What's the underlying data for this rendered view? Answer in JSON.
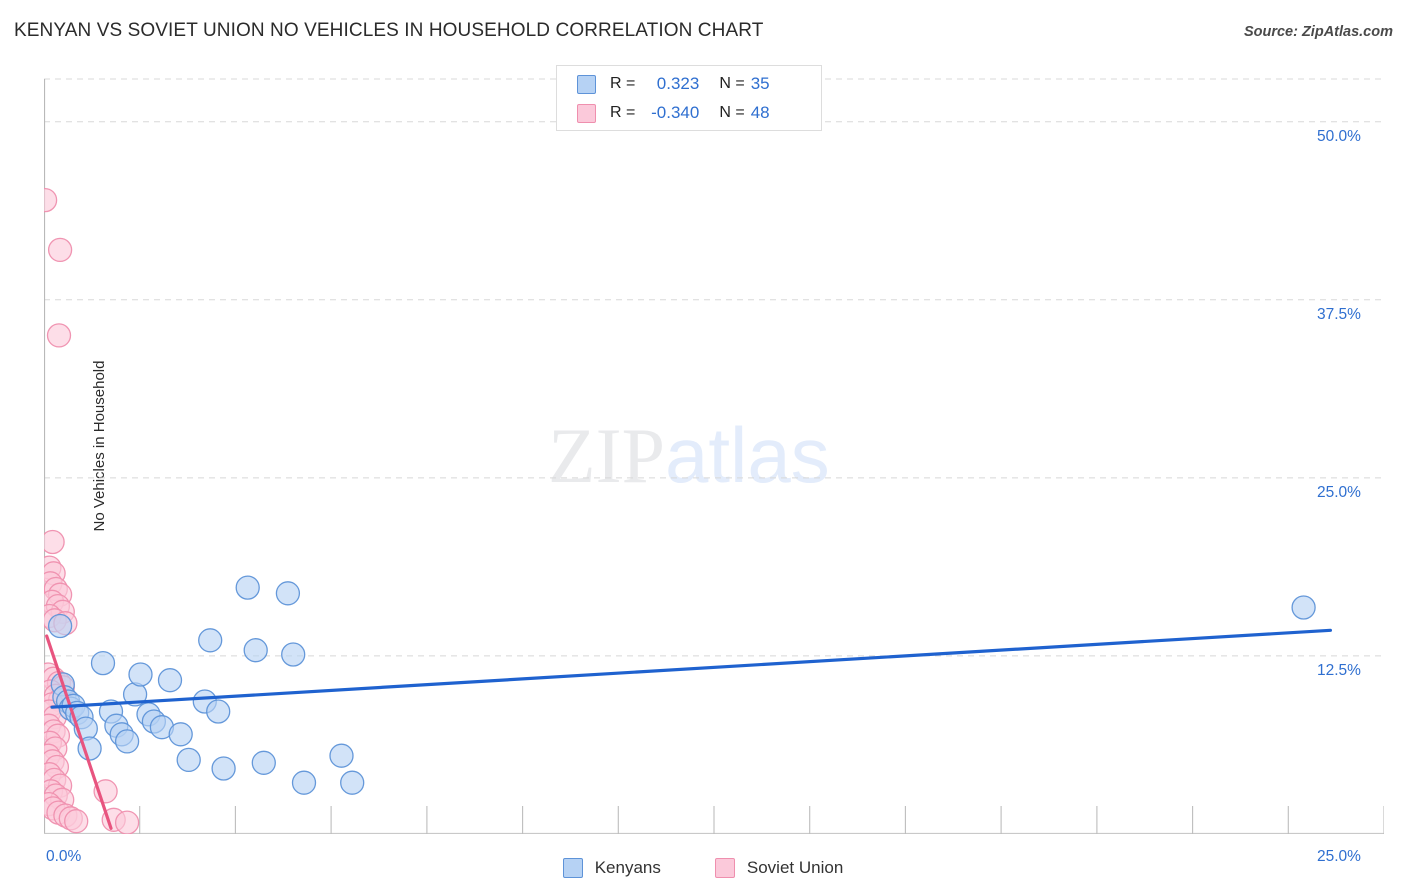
{
  "header": {
    "title": "KENYAN VS SOVIET UNION NO VEHICLES IN HOUSEHOLD CORRELATION CHART",
    "source": "Source: ZipAtlas.com"
  },
  "watermark": {
    "part1": "ZIP",
    "part2": "atlas"
  },
  "stats_legend": {
    "rows": [
      {
        "series": "Kenyans",
        "r_label": "R =",
        "r_value": "0.323",
        "n_label": "N =",
        "n_value": "35",
        "color": "#b6d2f4"
      },
      {
        "series": "Soviet Union",
        "r_label": "R =",
        "r_value": "-0.340",
        "n_label": "N =",
        "n_value": "48",
        "color": "#fbc9da"
      }
    ]
  },
  "bottom_legend": {
    "items": [
      {
        "label": "Kenyans",
        "color": "#b6d2f4",
        "border": "#5e93d8"
      },
      {
        "label": "Soviet Union",
        "color": "#fbc9da",
        "border": "#ef8fae"
      }
    ]
  },
  "chart_data": {
    "type": "scatter",
    "title": "KENYAN VS SOVIET UNION NO VEHICLES IN HOUSEHOLD CORRELATION CHART",
    "xlabel": "",
    "ylabel": "No Vehicles in Household",
    "xlim": [
      0.0,
      25.0
    ],
    "ylim": [
      0.0,
      53.0
    ],
    "x_unit": "%",
    "y_unit": "%",
    "grid": true,
    "legend_position": "bottom",
    "x_ticks": [
      {
        "value": 0.0,
        "label": "0.0%"
      },
      {
        "value": 25.0,
        "label": "25.0%"
      }
    ],
    "y_ticks": [
      {
        "value": 12.5,
        "label": "12.5%"
      },
      {
        "value": 25.0,
        "label": "25.0%"
      },
      {
        "value": 37.5,
        "label": "37.5%"
      },
      {
        "value": 50.0,
        "label": "50.0%"
      }
    ],
    "y_tick_side": "right",
    "series": [
      {
        "name": "Kenyans",
        "color": "#b6d2f4",
        "border": "#5e93d8",
        "r": 0.323,
        "n": 35,
        "trendline": {
          "x1": 0.15,
          "y1": 8.9,
          "x2": 24.0,
          "y2": 14.3,
          "color": "#1f62cf"
        },
        "points": [
          [
            0.3,
            14.6
          ],
          [
            0.35,
            10.5
          ],
          [
            0.38,
            9.6
          ],
          [
            0.45,
            9.3
          ],
          [
            0.5,
            8.8
          ],
          [
            0.55,
            9.0
          ],
          [
            0.62,
            8.5
          ],
          [
            0.7,
            8.2
          ],
          [
            0.78,
            7.4
          ],
          [
            0.85,
            6.0
          ],
          [
            1.1,
            12.0
          ],
          [
            1.25,
            8.6
          ],
          [
            1.35,
            7.6
          ],
          [
            1.45,
            7.0
          ],
          [
            1.55,
            6.5
          ],
          [
            1.7,
            9.8
          ],
          [
            1.8,
            11.2
          ],
          [
            1.95,
            8.4
          ],
          [
            2.05,
            7.9
          ],
          [
            2.2,
            7.5
          ],
          [
            2.35,
            10.8
          ],
          [
            2.55,
            7.0
          ],
          [
            2.7,
            5.2
          ],
          [
            3.0,
            9.3
          ],
          [
            3.1,
            13.6
          ],
          [
            3.25,
            8.6
          ],
          [
            3.35,
            4.6
          ],
          [
            3.8,
            17.3
          ],
          [
            3.95,
            12.9
          ],
          [
            4.1,
            5.0
          ],
          [
            4.55,
            16.9
          ],
          [
            4.65,
            12.6
          ],
          [
            4.85,
            3.6
          ],
          [
            5.55,
            5.5
          ],
          [
            5.75,
            3.6
          ],
          [
            23.5,
            15.9
          ]
        ]
      },
      {
        "name": "Soviet Union",
        "color": "#fbc9da",
        "border": "#ef8fae",
        "r": -0.34,
        "n": 48,
        "trendline": {
          "x1": 0.05,
          "y1": 13.9,
          "x2": 1.25,
          "y2": 0.4,
          "color": "#e8547f"
        },
        "points": [
          [
            0.02,
            44.5
          ],
          [
            0.3,
            41.0
          ],
          [
            0.28,
            35.0
          ],
          [
            0.16,
            20.5
          ],
          [
            0.1,
            18.7
          ],
          [
            0.18,
            18.3
          ],
          [
            0.12,
            17.6
          ],
          [
            0.22,
            17.2
          ],
          [
            0.3,
            16.8
          ],
          [
            0.15,
            16.3
          ],
          [
            0.26,
            16.0
          ],
          [
            0.35,
            15.6
          ],
          [
            0.1,
            15.3
          ],
          [
            0.2,
            15.0
          ],
          [
            0.4,
            14.8
          ],
          [
            0.08,
            11.2
          ],
          [
            0.18,
            10.9
          ],
          [
            0.28,
            10.6
          ],
          [
            0.35,
            10.3
          ],
          [
            0.12,
            10.0
          ],
          [
            0.22,
            9.7
          ],
          [
            0.3,
            9.4
          ],
          [
            0.15,
            9.1
          ],
          [
            0.1,
            8.6
          ],
          [
            0.2,
            8.2
          ],
          [
            0.09,
            7.6
          ],
          [
            0.18,
            7.2
          ],
          [
            0.26,
            6.9
          ],
          [
            0.11,
            6.4
          ],
          [
            0.21,
            6.0
          ],
          [
            0.08,
            5.5
          ],
          [
            0.16,
            5.1
          ],
          [
            0.24,
            4.7
          ],
          [
            0.1,
            4.2
          ],
          [
            0.19,
            3.8
          ],
          [
            0.3,
            3.4
          ],
          [
            0.13,
            3.0
          ],
          [
            0.22,
            2.7
          ],
          [
            0.34,
            2.4
          ],
          [
            0.09,
            2.1
          ],
          [
            0.17,
            1.8
          ],
          [
            0.27,
            1.5
          ],
          [
            0.4,
            1.3
          ],
          [
            0.5,
            1.1
          ],
          [
            0.6,
            0.9
          ],
          [
            1.15,
            3.0
          ],
          [
            1.3,
            1.0
          ],
          [
            1.55,
            0.8
          ]
        ]
      }
    ]
  }
}
